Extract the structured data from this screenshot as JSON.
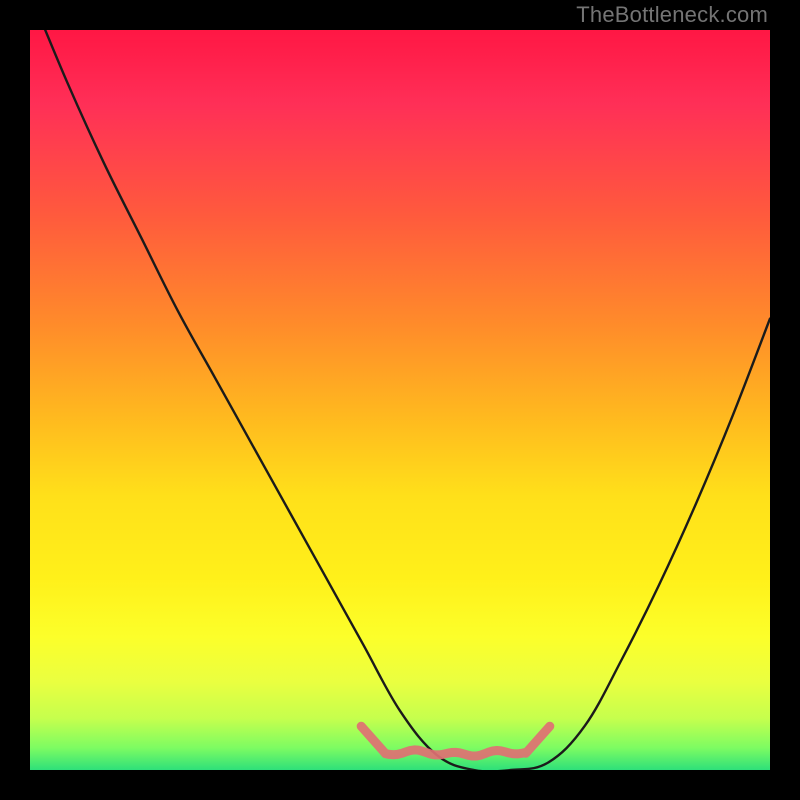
{
  "watermark": "TheBottleneck.com",
  "colors": {
    "background": "#000000",
    "curve": "#1b1b1b",
    "flat_marker": "#e07073",
    "gradient_stops": [
      "#ff1744",
      "#ff2f57",
      "#ff5a3d",
      "#ff8c2a",
      "#ffb81f",
      "#ffe01a",
      "#fff01a",
      "#fcff2a",
      "#eaff40",
      "#c6ff4d",
      "#7dfc62",
      "#2ee07a"
    ]
  },
  "chart_data": {
    "type": "line",
    "title": "",
    "xlabel": "",
    "ylabel": "",
    "xlim": [
      0,
      100
    ],
    "ylim": [
      0,
      100
    ],
    "x": [
      0,
      5,
      10,
      15,
      20,
      25,
      30,
      35,
      40,
      45,
      50,
      55,
      60,
      65,
      70,
      75,
      80,
      85,
      90,
      95,
      100
    ],
    "series": [
      {
        "name": "bottleneck-curve",
        "values": [
          105,
          93,
          82,
          72,
          62,
          53,
          44,
          35,
          26,
          17,
          8,
          2,
          0,
          0,
          1,
          6,
          15,
          25,
          36,
          48,
          61
        ]
      }
    ],
    "floor_region": {
      "x_start": 48,
      "x_end": 67,
      "y": 2
    }
  }
}
